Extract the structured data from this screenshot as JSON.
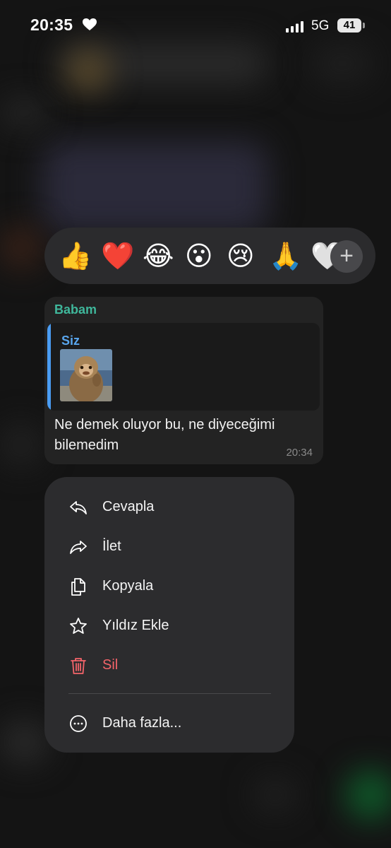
{
  "status_bar": {
    "time": "20:35",
    "network": "5G",
    "battery": "41"
  },
  "reactions": {
    "emojis": [
      "👍",
      "❤️",
      "😂",
      "😮",
      "😢",
      "🙏",
      "🤍"
    ],
    "more_icon": "plus-icon"
  },
  "message": {
    "sender": "Babam",
    "quoted_author": "Siz",
    "text": "Ne demek oluyor bu, ne diyeceğimi bilemedim",
    "time": "20:34"
  },
  "menu": {
    "items": [
      {
        "label": "Cevapla",
        "icon": "reply-icon"
      },
      {
        "label": "İlet",
        "icon": "forward-icon"
      },
      {
        "label": "Kopyala",
        "icon": "copy-icon"
      },
      {
        "label": "Yıldız Ekle",
        "icon": "star-icon"
      },
      {
        "label": "Sil",
        "icon": "trash-icon",
        "color": "#f4646a"
      },
      {
        "label": "Daha fazla...",
        "icon": "more-icon"
      }
    ]
  }
}
